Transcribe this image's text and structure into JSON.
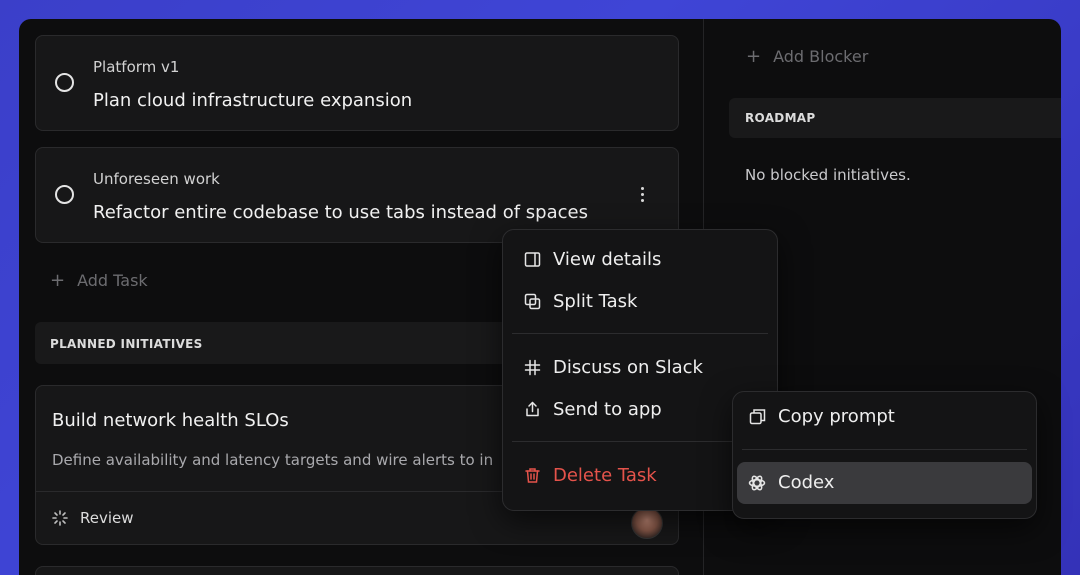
{
  "tasks": [
    {
      "project": "Platform v1",
      "title": "Plan cloud infrastructure expansion"
    },
    {
      "project": "Unforeseen work",
      "title": "Refactor entire codebase to use tabs instead of spaces"
    }
  ],
  "add_task_label": "Add Task",
  "planned_header": "PLANNED INITIATIVES",
  "initiative": {
    "title": "Build network health SLOs",
    "description": "Define availability and latency targets and wire alerts to in",
    "status": "Review"
  },
  "right": {
    "add_blocker_label": "Add Blocker",
    "roadmap_header": "ROADMAP",
    "empty_text": "No blocked initiatives."
  },
  "context_menu": {
    "view_details": "View details",
    "split_task": "Split Task",
    "discuss_slack": "Discuss on Slack",
    "send_to_app": "Send to app",
    "delete_task": "Delete Task"
  },
  "submenu": {
    "copy_prompt": "Copy prompt",
    "codex": "Codex"
  },
  "colors": {
    "background_gradient": "#3b3fc9",
    "danger": "#e5534b",
    "highlight": "#3a3a3d"
  },
  "icons": [
    "circle-icon",
    "more-vertical-icon",
    "plus-icon",
    "spinner-icon",
    "panel-icon",
    "split-icon",
    "slack-icon",
    "share-icon",
    "trash-icon",
    "copy-icon",
    "openai-icon"
  ]
}
